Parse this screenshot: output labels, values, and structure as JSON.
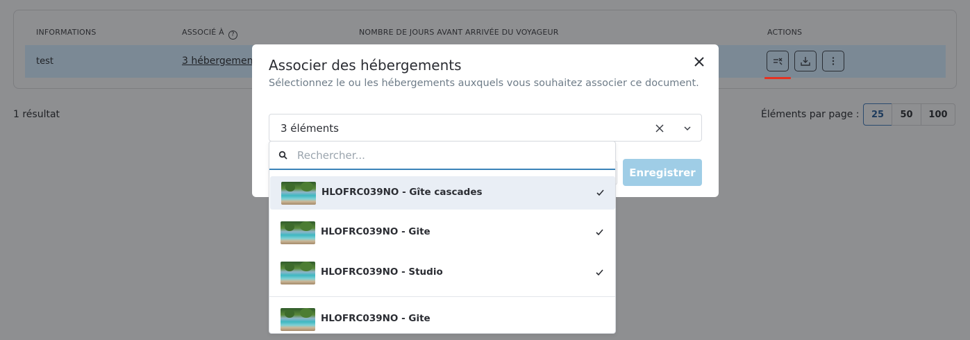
{
  "table": {
    "headers": {
      "informations": "INFORMATIONS",
      "associe": "ASSOCIÉ À",
      "jours": "NOMBRE DE JOURS AVANT ARRIVÉE DU VOYAGEUR",
      "actions": "ACTIONS"
    },
    "row": {
      "info": "test",
      "link": "3 hébergements"
    },
    "help_icon": "?"
  },
  "footer": {
    "results": "1 résultat",
    "per_page_label": "Éléments par page :",
    "page_sizes": [
      "25",
      "50",
      "100"
    ],
    "selected_page_size": "25"
  },
  "modal": {
    "title": "Associer des hébergements",
    "subtitle": "Sélectionnez le ou les hébergements auxquels vous souhaitez associer ce document.",
    "select_value": "3 éléments",
    "save_label": "Enregistrer",
    "search_placeholder": "Rechercher...",
    "options": [
      {
        "label": "HLOFRC039NO - Gîte cascades",
        "checked": true,
        "highlighted": true
      },
      {
        "label": "HLOFRC039NO - Gite",
        "checked": true,
        "highlighted": false
      },
      {
        "label": "HLOFRC039NO - Studio",
        "checked": true,
        "highlighted": false
      },
      {
        "label": "HLOFRC039NO - Gite",
        "checked": false,
        "highlighted": false
      }
    ]
  },
  "colors": {
    "overlay": "#8e8f91",
    "accent": "#3a83b8",
    "save_disabled": "#9fcde6",
    "active_underline": "#e53222"
  },
  "icons": [
    "help-icon",
    "unlink-icon",
    "download-icon",
    "more-vertical-icon",
    "close-icon",
    "clear-icon",
    "chevron-down-icon",
    "search-icon",
    "check-icon"
  ]
}
